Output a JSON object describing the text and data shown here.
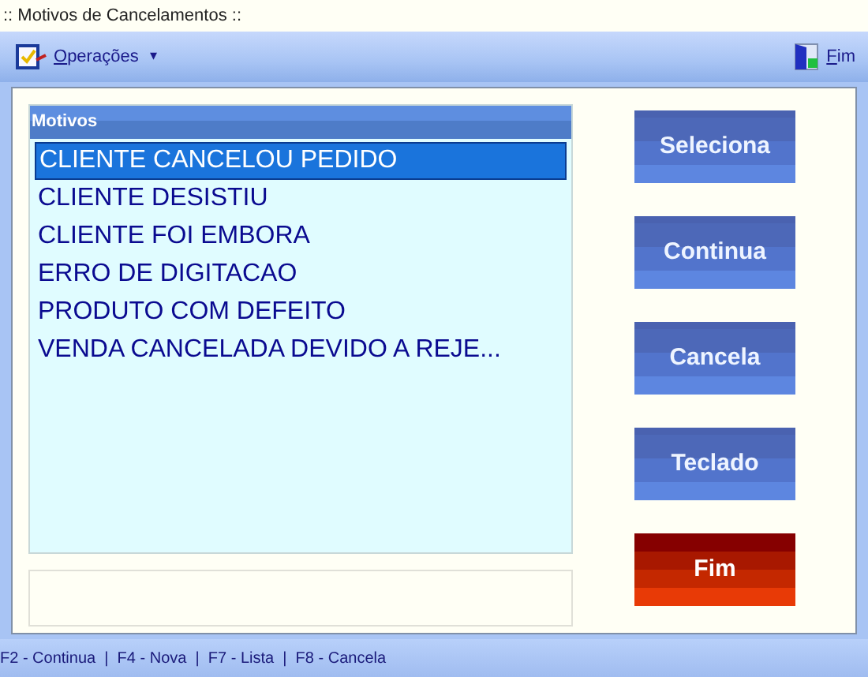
{
  "window": {
    "title": ":: Motivos de Cancelamentos ::"
  },
  "toolbar": {
    "menu": {
      "label": "Operações",
      "caret": "▾"
    },
    "exit": {
      "label": "Fim"
    }
  },
  "list": {
    "header": "Motivos",
    "items": [
      {
        "label": "CLIENTE CANCELOU PEDIDO",
        "selected": true
      },
      {
        "label": "CLIENTE DESISTIU",
        "selected": false
      },
      {
        "label": "CLIENTE FOI EMBORA",
        "selected": false
      },
      {
        "label": "ERRO DE DIGITACAO",
        "selected": false
      },
      {
        "label": "PRODUTO COM DEFEITO",
        "selected": false
      },
      {
        "label": "VENDA CANCELADA DEVIDO A REJE...",
        "selected": false
      }
    ]
  },
  "buttons": [
    {
      "label": "Seleciona",
      "kind": "blue"
    },
    {
      "label": "Continua",
      "kind": "blue"
    },
    {
      "label": "Cancela",
      "kind": "blue"
    },
    {
      "label": "Teclado",
      "kind": "blue"
    },
    {
      "label": "Fim",
      "kind": "red"
    }
  ],
  "status_bar": "F2 - Continua  |  F4 - Nova  |  F7 - Lista  |  F8 - Cancela"
}
